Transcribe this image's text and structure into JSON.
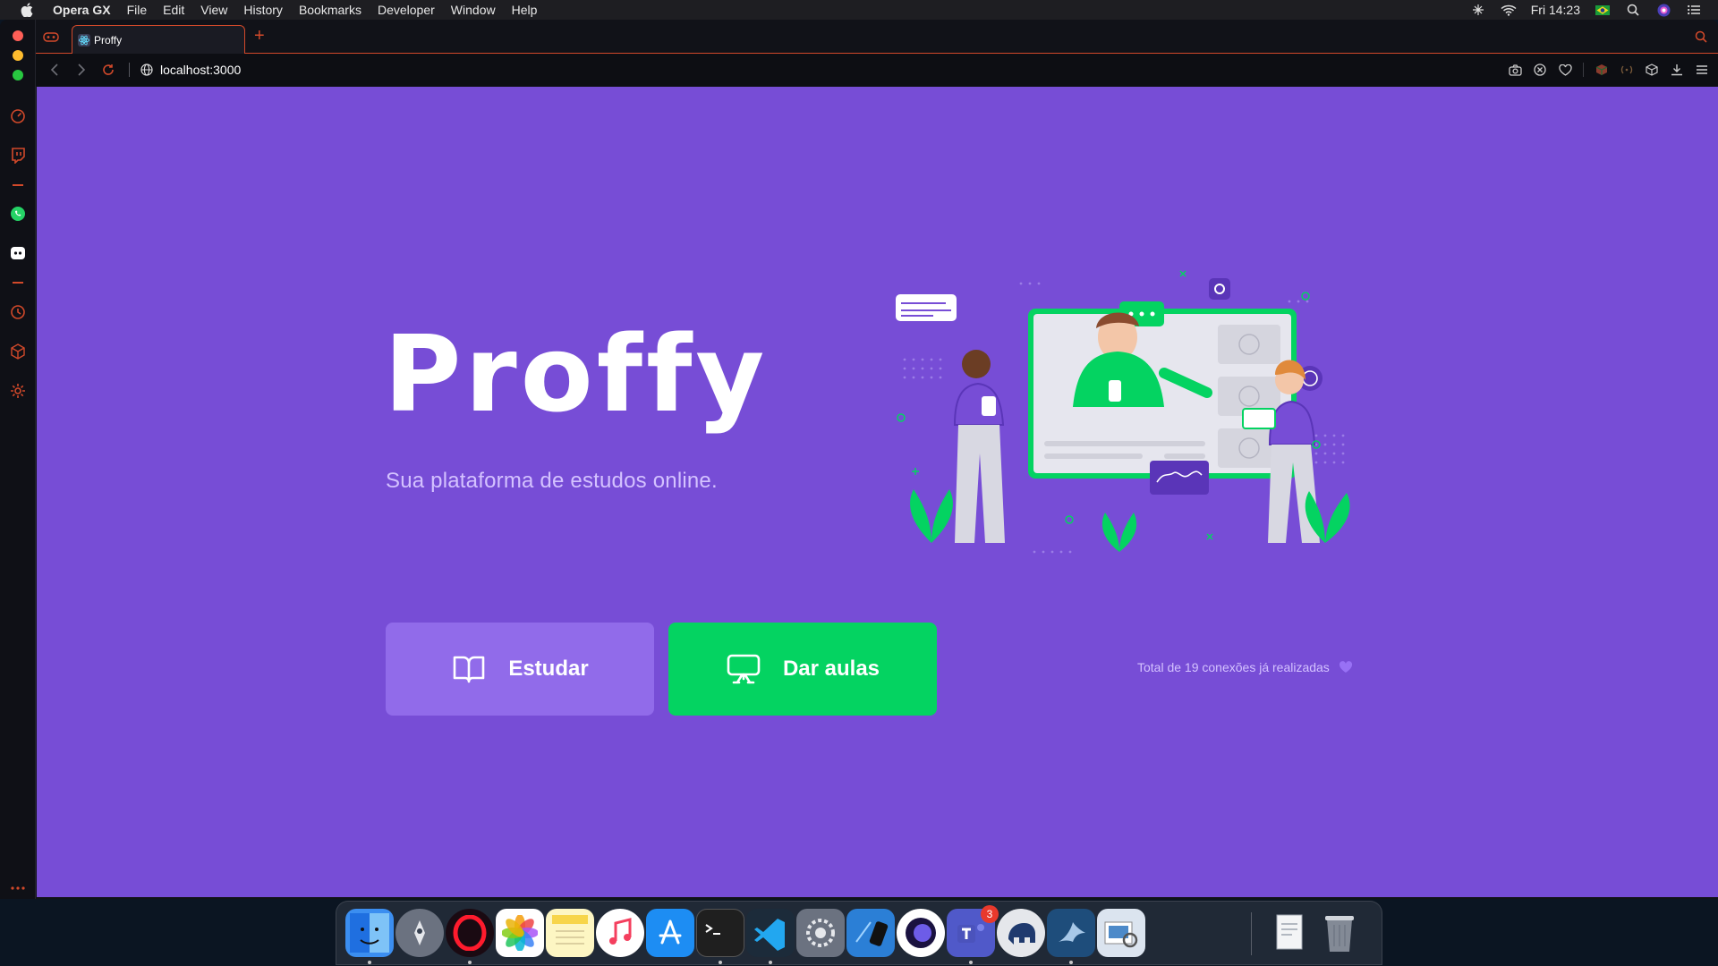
{
  "menubar": {
    "app_name": "Opera GX",
    "items": [
      "File",
      "Edit",
      "View",
      "History",
      "Bookmarks",
      "Developer",
      "Window",
      "Help"
    ],
    "clock": "Fri 14:23"
  },
  "browser": {
    "tab_title": "Proffy",
    "new_tab_symbol": "+",
    "url": "localhost:3000"
  },
  "page": {
    "logo_text": "Proffy",
    "tagline": "Sua plataforma de estudos online.",
    "study_button": "Estudar",
    "teach_button": "Dar aulas",
    "connections_text": "Total de 19 conexões já realizadas"
  },
  "dock": {
    "teams_badge": "3",
    "items": [
      "finder-icon",
      "launchpad-icon",
      "opera-icon",
      "photos-icon",
      "notes-icon",
      "music-icon",
      "app-store-icon",
      "terminal-icon",
      "vscode-icon",
      "system-preferences-icon",
      "simulator-icon",
      "opera-gx-icon",
      "teams-icon",
      "tableplus-icon",
      "mysql-workbench-icon",
      "preview-icon",
      "pdf-document-icon",
      "trash-icon"
    ]
  },
  "colors": {
    "primary": "#774dd6",
    "primary_light": "#916bea",
    "secondary": "#04d361",
    "text_light": "#d4c2ff",
    "opera_accent": "#d2492a"
  }
}
